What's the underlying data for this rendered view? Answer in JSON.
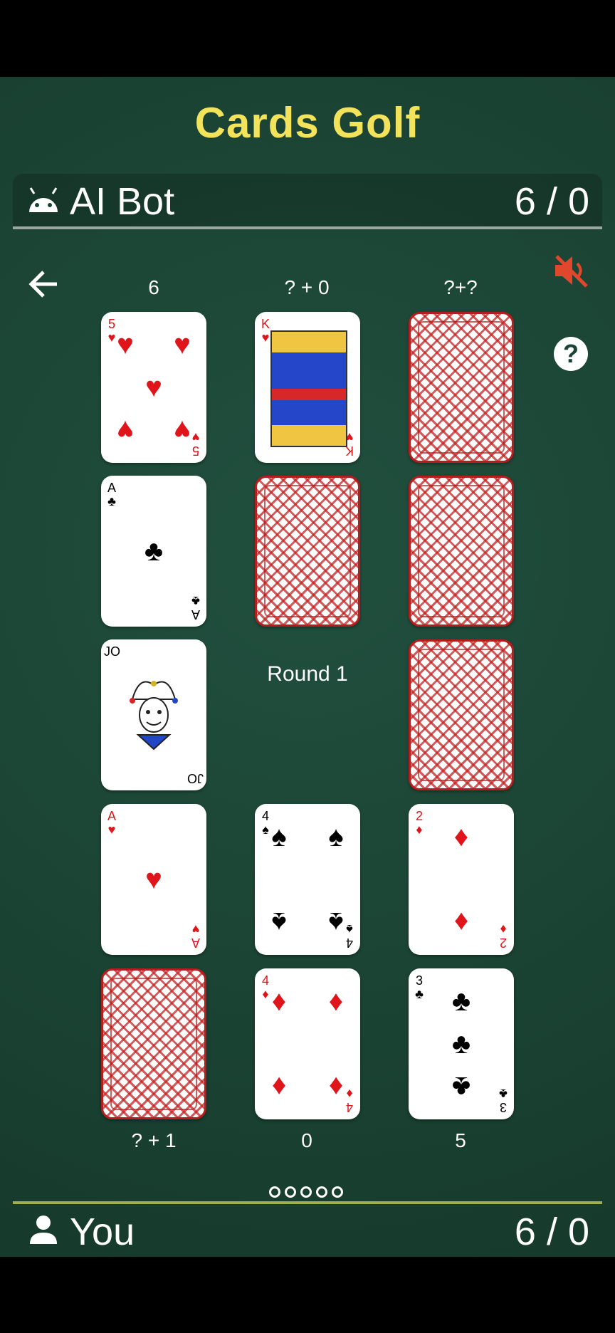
{
  "app": {
    "title": "Cards Golf"
  },
  "opponent": {
    "name": "AI Bot",
    "score": "6 / 0",
    "icon": "android-icon"
  },
  "player": {
    "name": "You",
    "score": "6 / 0",
    "icon": "person-icon"
  },
  "controls": {
    "back_icon": "arrow-left-icon",
    "mute_icon": "volume-off-icon",
    "help_label": "?"
  },
  "columns_top": [
    "6",
    "? + 0",
    "?+?"
  ],
  "columns_bottom": [
    "? + 1",
    "0",
    "5"
  ],
  "round_label": "Round 1",
  "cards": [
    {
      "rank": "5",
      "suit": "♥",
      "color": "red",
      "face": "up"
    },
    {
      "rank": "K",
      "suit": "♥",
      "color": "red",
      "face": "up"
    },
    {
      "face": "down"
    },
    {
      "rank": "A",
      "suit": "♣",
      "color": "blk",
      "face": "up"
    },
    {
      "face": "down"
    },
    {
      "face": "down"
    },
    {
      "rank": "JO",
      "suit": "",
      "color": "blk",
      "face": "up"
    },
    {
      "face": "empty"
    },
    {
      "face": "down"
    },
    {
      "rank": "A",
      "suit": "♥",
      "color": "red",
      "face": "up"
    },
    {
      "rank": "4",
      "suit": "♠",
      "color": "blk",
      "face": "up"
    },
    {
      "rank": "2",
      "suit": "♦",
      "color": "red",
      "face": "up"
    },
    {
      "face": "down"
    },
    {
      "rank": "4",
      "suit": "♦",
      "color": "red",
      "face": "up"
    },
    {
      "rank": "3",
      "suit": "♣",
      "color": "blk",
      "face": "up"
    }
  ],
  "page_indicator": {
    "count": 5
  },
  "colors": {
    "felt": "#1b4434",
    "title": "#f2e35a",
    "mute": "#e0472c",
    "card_back": "#b31e1e"
  }
}
